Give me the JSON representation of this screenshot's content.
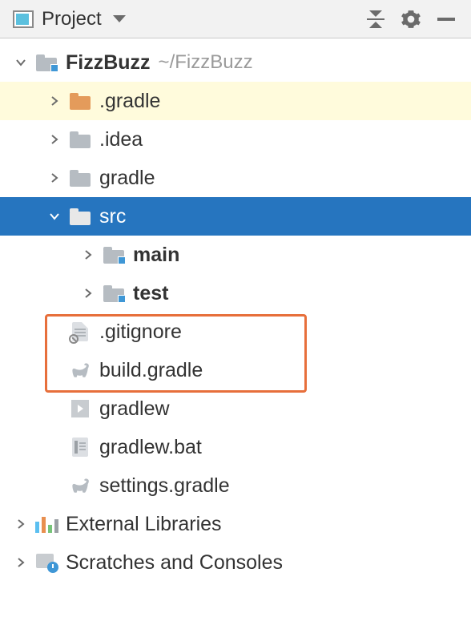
{
  "header": {
    "title": "Project"
  },
  "tree": {
    "root": {
      "name": "FizzBuzz",
      "path": "~/FizzBuzz",
      "children": {
        "gradle_dot": ".gradle",
        "idea": ".idea",
        "gradle": "gradle",
        "src": "src",
        "main": "main",
        "test": "test",
        "gitignore": ".gitignore",
        "build_gradle": "build.gradle",
        "gradlew": "gradlew",
        "gradlew_bat": "gradlew.bat",
        "settings_gradle": "settings.gradle"
      }
    },
    "external_libs": "External Libraries",
    "scratches": "Scratches and Consoles"
  }
}
